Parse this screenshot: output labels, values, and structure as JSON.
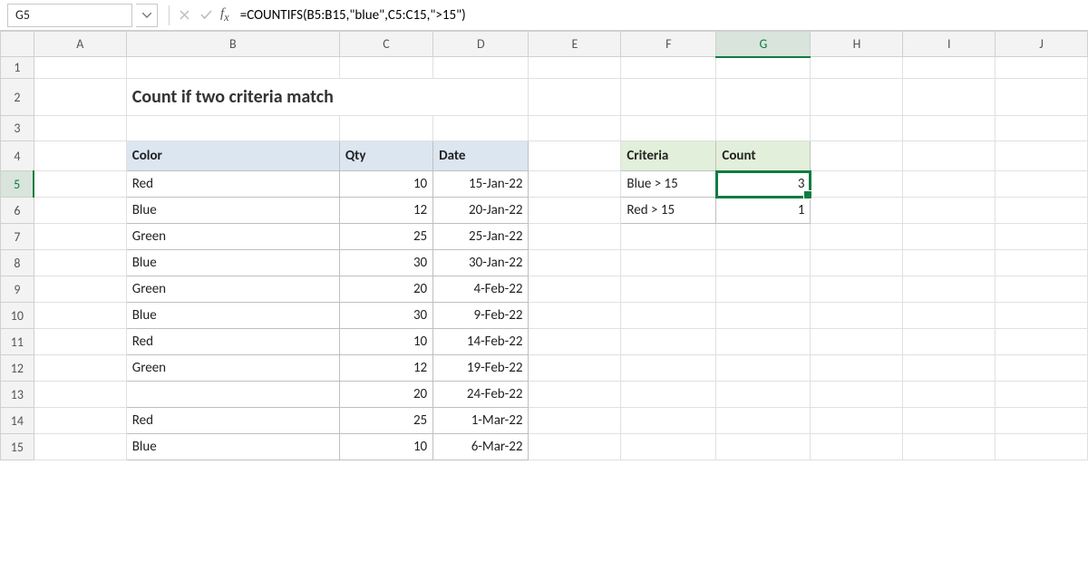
{
  "name_box": "G5",
  "formula": "=COUNTIFS(B5:B15,\"blue\",C5:C15,\">15\")",
  "columns": [
    "A",
    "B",
    "C",
    "D",
    "E",
    "F",
    "G",
    "H",
    "I",
    "J"
  ],
  "rows": [
    "1",
    "2",
    "3",
    "4",
    "5",
    "6",
    "7",
    "8",
    "9",
    "10",
    "11",
    "12",
    "13",
    "14",
    "15"
  ],
  "title": "Count if two criteria match",
  "table1": {
    "h1": "Color",
    "h2": "Qty",
    "h3": "Date",
    "rows": [
      {
        "c": "Red",
        "q": "10",
        "d": "15-Jan-22"
      },
      {
        "c": "Blue",
        "q": "12",
        "d": "20-Jan-22"
      },
      {
        "c": "Green",
        "q": "25",
        "d": "25-Jan-22"
      },
      {
        "c": "Blue",
        "q": "30",
        "d": "30-Jan-22"
      },
      {
        "c": "Green",
        "q": "20",
        "d": "4-Feb-22"
      },
      {
        "c": "Blue",
        "q": "30",
        "d": "9-Feb-22"
      },
      {
        "c": "Red",
        "q": "10",
        "d": "14-Feb-22"
      },
      {
        "c": "Green",
        "q": "12",
        "d": "19-Feb-22"
      },
      {
        "c": "",
        "q": "20",
        "d": "24-Feb-22"
      },
      {
        "c": "Red",
        "q": "25",
        "d": "1-Mar-22"
      },
      {
        "c": "Blue",
        "q": "10",
        "d": "6-Mar-22"
      }
    ]
  },
  "table2": {
    "h1": "Criteria",
    "h2": "Count",
    "rows": [
      {
        "crit": "Blue > 15",
        "cnt": "3"
      },
      {
        "crit": "Red > 15",
        "cnt": "1"
      }
    ]
  },
  "colors": {
    "accent": "#107c41",
    "header_fill_blue": "#dce6f1",
    "header_fill_green": "#e2efda"
  }
}
